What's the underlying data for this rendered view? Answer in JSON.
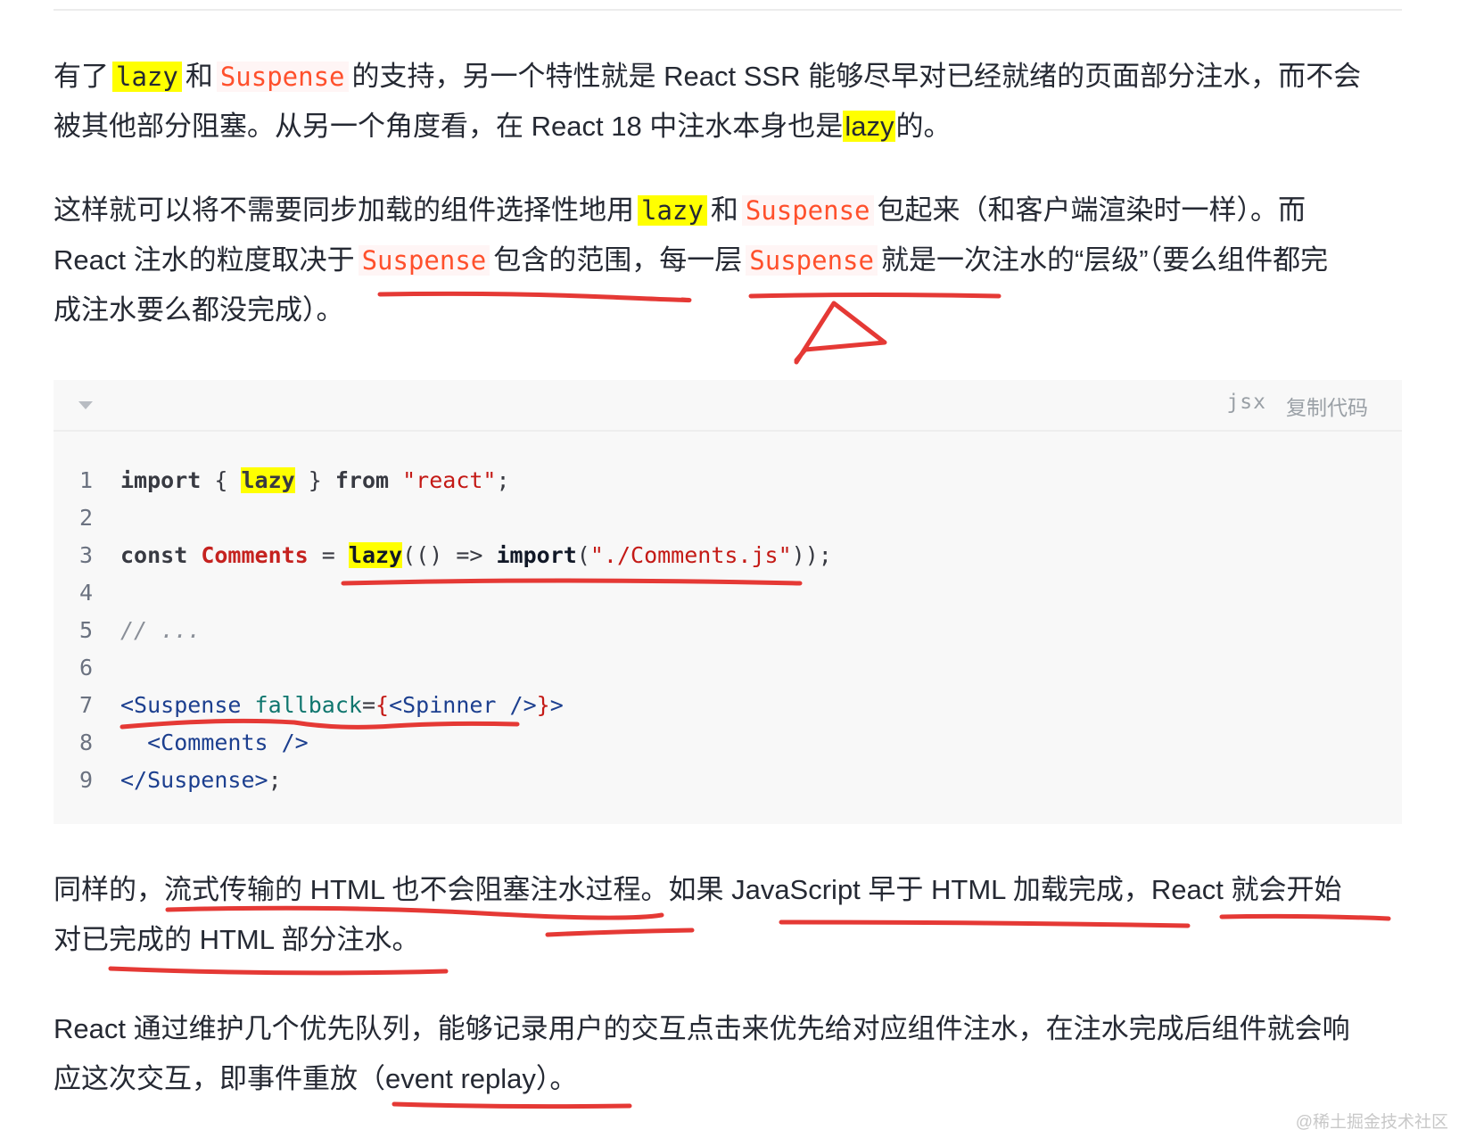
{
  "paragraphs": {
    "p1": {
      "line1": {
        "t1": "有了",
        "lazy": "lazy",
        "t2": "和",
        "suspense": "Suspense",
        "t3": "的支持，另一个特性就是 React SSR 能够尽早对已经就绪的页面部分注水，而不会"
      },
      "line2": {
        "t1": "被其他部分阻塞。从另一个角度看，在 React 18 中注水本身也是",
        "lazy": "lazy",
        "t2": "的。"
      }
    },
    "p2": {
      "line1": {
        "t1": "这样就可以将不需要同步加载的组件选择性地用",
        "lazy": "lazy",
        "t2": "和",
        "suspense": "Suspense",
        "t3": "包起来（和客户端渲染时一样）。而"
      },
      "line2": {
        "t1": "React 注水的粒度取决于",
        "suspense1": "Suspense",
        "t2": "包含的范围，每一层",
        "suspense2": "Suspense",
        "t3": "就是一次注水的“层级”（要么组件都完"
      },
      "line3": {
        "t1": "成注水要么都没完成）。"
      }
    },
    "p3": {
      "line1": "同样的，流式传输的 HTML 也不会阻塞注水过程。如果 JavaScript 早于 HTML 加载完成，React 就会开始",
      "line2": "对已完成的 HTML 部分注水。"
    },
    "p4": {
      "line1": "React 通过维护几个优先队列，能够记录用户的交互点击来优先给对应组件注水，在注水完成后组件就会响",
      "line2": "应这次交互，即事件重放（event replay）。"
    }
  },
  "code_block": {
    "language": "jsx",
    "copy_label": "复制代码",
    "line_numbers": [
      "1",
      "2",
      "3",
      "4",
      "5",
      "6",
      "7",
      "8",
      "9"
    ],
    "lines": {
      "l1": {
        "import": "import",
        "open": " { ",
        "lazy": "lazy",
        "close": " } ",
        "from": "from",
        "space": " ",
        "str": "\"react\"",
        "end": ";"
      },
      "l3": {
        "const": "const",
        "space": " ",
        "name": "Comments",
        "eq": " = ",
        "lazy": "lazy",
        "p1": "(() => ",
        "import": "import",
        "p2": "(",
        "str": "\"./Comments.js\"",
        "end": "));"
      },
      "l5": {
        "comment": "// ..."
      },
      "l7": {
        "open": "<Suspense",
        "space": " ",
        "attr": "fallback",
        "eq": "=",
        "brace1": "{",
        "tag": "<Spinner />",
        "brace2": "}",
        "close": ">"
      },
      "l8": {
        "indent": "  ",
        "tag": "<Comments />"
      },
      "l9": {
        "tag": "</Suspense>",
        "end": ";"
      }
    }
  },
  "watermark": "@稀土掘金技术社区",
  "colors": {
    "highlight": "#ffff00",
    "inline_code": "#ff502c",
    "annotation": "#e53935",
    "code_bg": "#f8f8f8"
  }
}
